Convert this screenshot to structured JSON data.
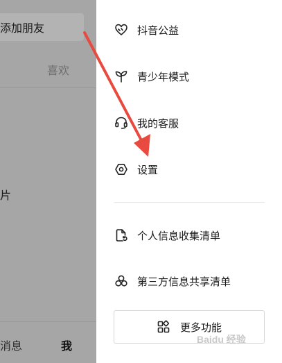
{
  "left_app": {
    "add_friend": "添加朋友",
    "like_tab": "喜欢",
    "photo_fragment": "片",
    "nav_messages": "消息",
    "nav_me": "我"
  },
  "drawer": {
    "items": [
      {
        "label": "抖音公益",
        "icon": "heart-hands-icon"
      },
      {
        "label": "青少年模式",
        "icon": "sprout-icon"
      },
      {
        "label": "我的客服",
        "icon": "headset-icon"
      },
      {
        "label": "设置",
        "icon": "hexagon-settings-icon"
      },
      {
        "label": "个人信息收集清单",
        "icon": "document-refresh-icon"
      },
      {
        "label": "第三方信息共享清单",
        "icon": "three-circles-icon"
      }
    ],
    "more_button": {
      "label": "更多功能",
      "icon": "grid-apps-icon"
    }
  },
  "annotation": {
    "color": "#e84a3f"
  },
  "watermark": "Baidu 经验"
}
